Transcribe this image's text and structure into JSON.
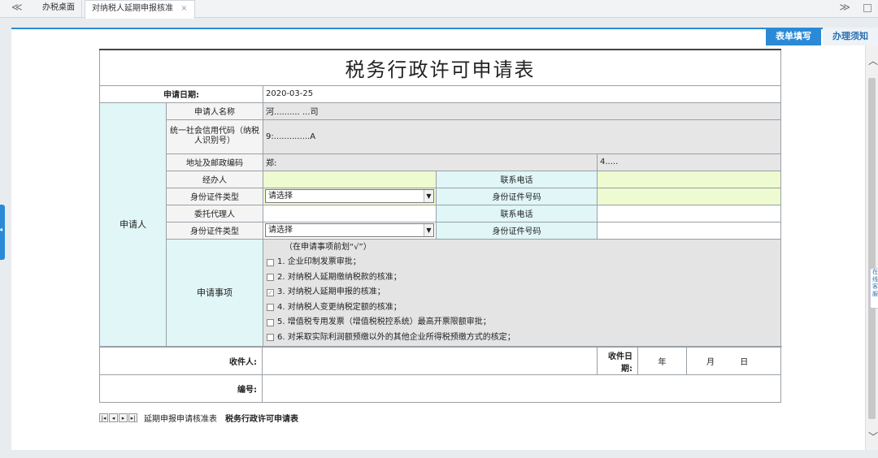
{
  "tabs": {
    "nav_left": "≪",
    "nav_right": "≫",
    "home": "办税桌面",
    "current": "对纳税人延期申报核准",
    "close": "×"
  },
  "mode_tabs": {
    "fill": "表单填写",
    "notice": "办理须知"
  },
  "right_float": "在线客服",
  "form": {
    "title": "税务行政许可申请表",
    "apply_date_label": "申请日期:",
    "apply_date_value": "2020-03-25",
    "applicant_group": "申请人",
    "name_label": "申请人名称",
    "name_value": "河.......... ...司",
    "credit_code_label": "统一社会信用代码（纳税人识别号）",
    "credit_code_value": "9:..............A",
    "address_label": "地址及邮政编码",
    "address_value": "郑:",
    "postal_value": "4.....",
    "handler_label": "经办人",
    "handler_value": "",
    "phone_label": "联系电话",
    "phone_value": "",
    "id_type_label": "身份证件类型",
    "id_type_value": "请选择",
    "id_no_label": "身份证件号码",
    "id_no_value": "",
    "agent_label": "委托代理人",
    "agent_value": "",
    "agent_phone_label": "联系电话",
    "agent_phone_value": "",
    "agent_id_type_label": "身份证件类型",
    "agent_id_type_value": "请选择",
    "agent_id_no_label": "身份证件号码",
    "agent_id_no_value": "",
    "matters_group": "申请事项",
    "matters_head": "（在申请事项前划“√”）",
    "matters": [
      {
        "label": "1. 企业印制发票审批；",
        "checked": false
      },
      {
        "label": "2. 对纳税人延期缴纳税款的核准；",
        "checked": false
      },
      {
        "label": "3. 对纳税人延期申报的核准；",
        "checked": true
      },
      {
        "label": "4. 对纳税人变更纳税定额的核准；",
        "checked": false
      },
      {
        "label": "5. 增值税专用发票（增值税税控系统）最高开票限额审批；",
        "checked": false
      },
      {
        "label": "6. 对采取实际利润额预缴以外的其他企业所得税预缴方式的核定；",
        "checked": false
      }
    ],
    "receiver_label": "收件人:",
    "receive_date_label": "收件日期:",
    "year": "年",
    "month": "月",
    "day": "日",
    "serial_label": "编号:"
  },
  "sheet_tabs": {
    "tab1": "延期申报申请核准表",
    "tab2": "税务行政许可申请表"
  }
}
